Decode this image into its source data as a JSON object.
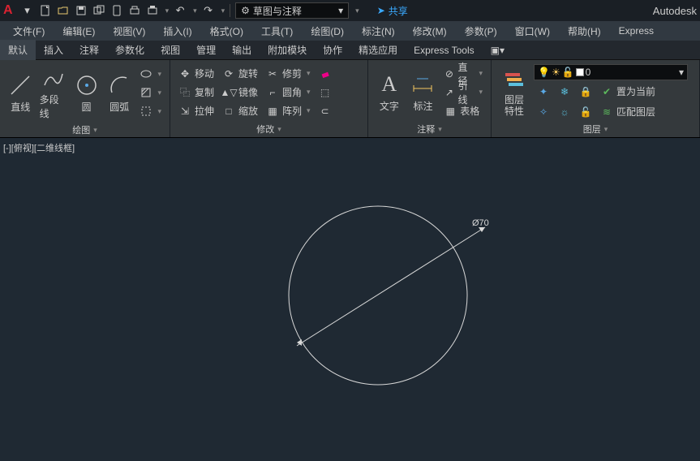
{
  "titlebar": {
    "workspace": "草图与注释",
    "share": "共享",
    "brand": "Autodesk"
  },
  "menubar": [
    "文件(F)",
    "编辑(E)",
    "视图(V)",
    "插入(I)",
    "格式(O)",
    "工具(T)",
    "绘图(D)",
    "标注(N)",
    "修改(M)",
    "参数(P)",
    "窗口(W)",
    "帮助(H)",
    "Express"
  ],
  "tabs": [
    "默认",
    "插入",
    "注释",
    "参数化",
    "视图",
    "管理",
    "输出",
    "附加模块",
    "协作",
    "精选应用",
    "Express Tools"
  ],
  "active_tab": "默认",
  "panels": {
    "draw": {
      "title": "绘图",
      "line": "直线",
      "polyline": "多段线",
      "circle": "圆",
      "arc": "圆弧"
    },
    "modify": {
      "title": "修改",
      "move": "移动",
      "rotate": "旋转",
      "trim": "修剪",
      "copy": "复制",
      "mirror": "镜像",
      "fillet": "圆角",
      "stretch": "拉伸",
      "scale": "缩放",
      "array": "阵列"
    },
    "annotation": {
      "title": "注释",
      "text": "文字",
      "dim": "标注",
      "linear": "直径",
      "leader": "引线",
      "table": "表格"
    },
    "layers": {
      "title": "图层",
      "props": "图层\n特性",
      "current": "0",
      "setcurrent": "置为当前",
      "match": "匹配图层"
    }
  },
  "viewport": {
    "label": "[-][俯视][二维线框]"
  },
  "drawing": {
    "dim_text": "Ø70"
  }
}
